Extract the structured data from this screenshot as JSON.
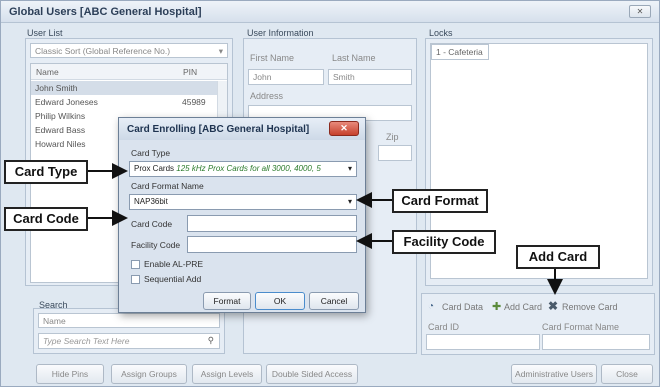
{
  "window": {
    "title": "Global Users [ABC General Hospital]",
    "close_icon": "close-icon"
  },
  "user_list": {
    "label": "User List",
    "sort_value": "Classic Sort (Global Reference No.)",
    "col_name": "Name",
    "col_pin": "PIN",
    "rows": [
      {
        "name": "John Smith",
        "pin": ""
      },
      {
        "name": "Edward Joneses",
        "pin": "45989"
      },
      {
        "name": "Philip Wilkins",
        "pin": ""
      },
      {
        "name": "Edward Bass",
        "pin": ""
      },
      {
        "name": "Howard Niles",
        "pin": ""
      }
    ]
  },
  "search": {
    "label": "Search",
    "field_value": "Name",
    "placeholder": "Type Search Text Here"
  },
  "user_info": {
    "label": "User Information",
    "first_name_label": "First Name",
    "last_name_label": "Last Name",
    "first_name": "John",
    "last_name": "Smith",
    "address_label": "Address",
    "zip_label": "Zip"
  },
  "locks": {
    "label": "Locks",
    "items": [
      "1 - Cafeteria"
    ]
  },
  "cards": {
    "card_data_label": "Card Data",
    "add_card_label": "Add Card",
    "remove_card_label": "Remove Card",
    "col_card_id": "Card ID",
    "col_format": "Card Format Name"
  },
  "bottom_buttons": {
    "hide_pins": "Hide Pins",
    "assign_groups": "Assign Groups",
    "assign_levels": "Assign Levels",
    "double_sided": "Double Sided Access",
    "admin_users": "Administrative Users",
    "close": "Close"
  },
  "dialog": {
    "title": "Card Enrolling [ABC General Hospital]",
    "card_type_label": "Card Type",
    "card_type_prefix": "Prox Cards",
    "card_type_detail": "125 kHz Prox Cards for all 3000, 4000, 5",
    "card_format_label": "Card Format Name",
    "card_format_value": "NAP36bit",
    "card_code_label": "Card Code",
    "facility_code_label": "Facility Code",
    "enable_al_pre": "Enable AL-PRE",
    "sequential_add": "Sequential Add",
    "format_button": "Format",
    "ok_button": "OK",
    "cancel_button": "Cancel"
  },
  "callouts": {
    "card_type": "Card Type",
    "card_code": "Card Code",
    "card_format": "Card Format",
    "facility_code": "Facility Code",
    "add_card": "Add Card"
  }
}
